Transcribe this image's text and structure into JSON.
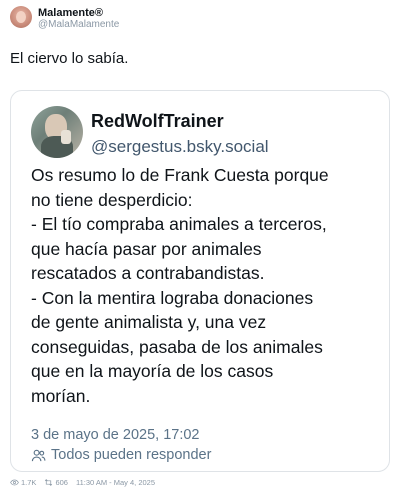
{
  "post": {
    "author_name": "Malamente®",
    "author_handle": "@MalaMalamente",
    "text": "El ciervo lo sabía."
  },
  "quote": {
    "author_name": "RedWolfTrainer",
    "author_handle": "@sergestus.bsky.social",
    "lines": [
      "Os resumo lo de Frank Cuesta porque",
      "no tiene desperdicio:",
      "- El tío compraba animales a terceros,",
      "que hacía pasar por animales",
      "rescatados a contrabandistas.",
      "- Con la mentira lograba donaciones",
      "de gente animalista y, una vez",
      "conseguidas, pasaba de los animales",
      "que en la mayoría de los casos",
      "morían."
    ],
    "date": "3 de mayo de 2025, 17:02",
    "reply_setting": "Todos pueden responder"
  },
  "footer": {
    "views": "1.7K",
    "reposts": "606",
    "timestamp": "11:30 AM - May 4, 2025"
  },
  "icons": {
    "reply_audience": "people-icon",
    "views": "eye-icon",
    "reposts": "repost-icon"
  }
}
